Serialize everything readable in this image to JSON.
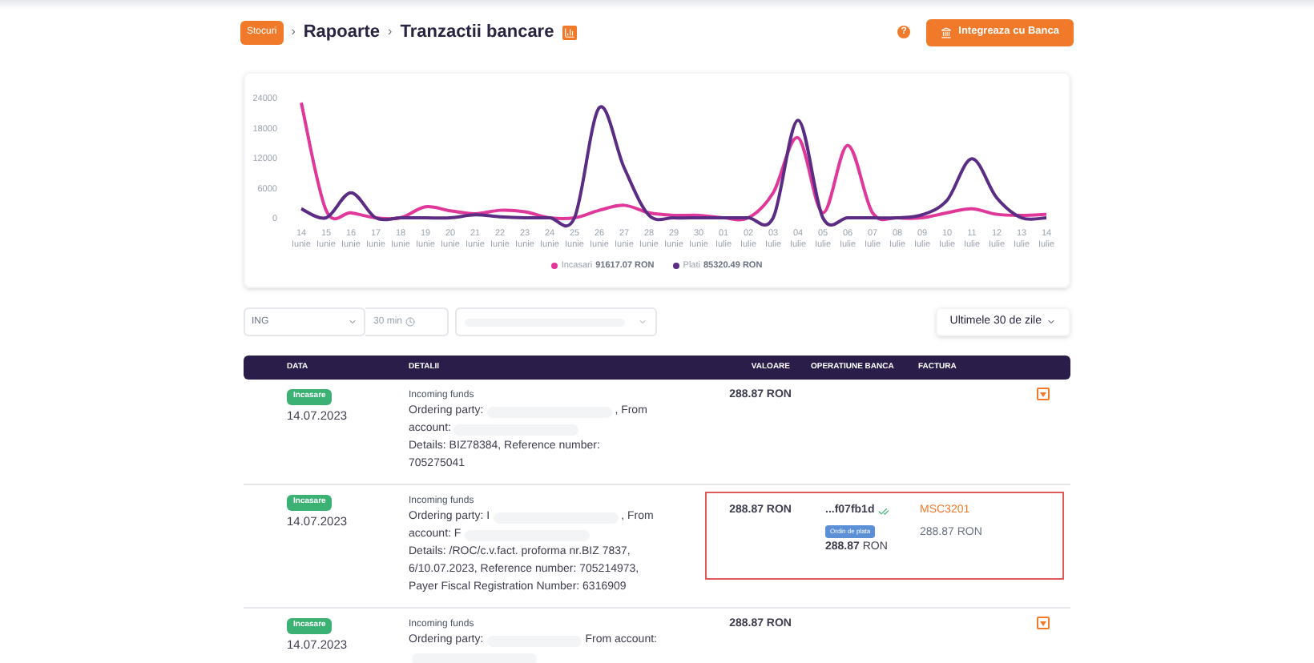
{
  "breadcrumb": [
    {
      "label": "Stocuri",
      "kind": "pill"
    },
    {
      "label": "Rapoarte",
      "kind": "link"
    },
    {
      "label": "Tranzactii bancare",
      "kind": "current"
    }
  ],
  "breadcrumb_separators": [
    "›",
    "›"
  ],
  "help": "?",
  "integrate_button": "Integreaza cu Banca",
  "chart": {
    "chart_data": {
      "type": "line",
      "categories": [
        "14 Iunie",
        "15 Iunie",
        "16 Iunie",
        "17 Iunie",
        "18 Iunie",
        "19 Iunie",
        "20 Iunie",
        "21 Iunie",
        "22 Iunie",
        "23 Iunie",
        "24 Iunie",
        "25 Iunie",
        "26 Iunie",
        "27 Iunie",
        "28 Iunie",
        "29 Iunie",
        "30 Iunie",
        "01 Iulie",
        "02 Iulie",
        "03 Iulie",
        "04 Iulie",
        "05 Iulie",
        "06 Iulie",
        "07 Iulie",
        "08 Iulie",
        "09 Iulie",
        "10 Iulie",
        "11 Iulie",
        "12 Iulie",
        "13 Iulie",
        "14 Iulie"
      ],
      "series": [
        {
          "name": "Incasari",
          "color": "#e0389a",
          "values": [
            23000,
            1500,
            1000,
            0,
            0,
            2200,
            1400,
            800,
            1500,
            1200,
            0,
            0,
            1500,
            2500,
            1000,
            500,
            500,
            0,
            0,
            5000,
            16000,
            1000,
            14500,
            1000,
            0,
            0,
            1000,
            1800,
            700,
            500,
            700
          ]
        },
        {
          "name": "Plati",
          "color": "#5b2c83",
          "values": [
            1800,
            0,
            5000,
            0,
            0,
            0,
            0,
            600,
            200,
            0,
            0,
            0,
            22000,
            10000,
            500,
            0,
            0,
            0,
            0,
            0,
            19500,
            0,
            0,
            0,
            0,
            600,
            3500,
            11800,
            4000,
            0,
            0
          ]
        }
      ],
      "ylim": [
        0,
        24000
      ],
      "yticks": [
        0,
        6000,
        12000,
        18000,
        24000
      ]
    },
    "legend_totals": [
      "91617.07 RON",
      "85320.49 RON"
    ]
  },
  "filters": {
    "bank": "ING",
    "time": "30 min",
    "period": "Ultimele 30 de zile"
  },
  "table": {
    "columns": [
      "DATA",
      "DETALII",
      "VALOARE",
      "OPERATIUNE BANCA",
      "FACTURA"
    ],
    "rows": [
      {
        "badge": "Incasare",
        "date": "14.07.2023",
        "title": "Incoming funds",
        "details": [
          [
            {
              "kind": "text",
              "text": "Ordering party:"
            },
            {
              "kind": "redacted"
            },
            {
              "kind": "text",
              "text": ", From"
            }
          ],
          [
            {
              "kind": "text",
              "text": "account:"
            },
            {
              "kind": "redacted"
            }
          ],
          [
            {
              "kind": "text",
              "text": "Details: BIZ78384, Reference number:"
            }
          ],
          [
            {
              "kind": "text",
              "text": "705275041"
            }
          ]
        ],
        "value": "288.87 RON",
        "highlighted": false,
        "action": true
      },
      {
        "badge": "Incasare",
        "date": "14.07.2023",
        "title": "Incoming funds",
        "details": [
          [
            {
              "kind": "text",
              "text": "Ordering party: I"
            },
            {
              "kind": "redacted"
            },
            {
              "kind": "text",
              "text": ", From"
            }
          ],
          [
            {
              "kind": "text",
              "text": "account: F"
            },
            {
              "kind": "redacted"
            }
          ],
          [
            {
              "kind": "text",
              "text": "Details: /ROC/c.v.fact. proforma nr.BIZ 7837,"
            }
          ],
          [
            {
              "kind": "text",
              "text": "6/10.07.2023, Reference number: 705214973,"
            }
          ],
          [
            {
              "kind": "text",
              "text": "Payer Fiscal Registration Number: 6316909"
            }
          ]
        ],
        "value": "288.87 RON",
        "highlighted": true,
        "action": false,
        "operation": {
          "ref": "...f07fb1d",
          "verified": true,
          "tag": "Ordin de plata",
          "amount": "**288.87** RON"
        },
        "invoice": {
          "number": "MSC3201",
          "amount": "288.87 RON"
        }
      },
      {
        "badge": "Incasare",
        "date": "14.07.2023",
        "title": "Incoming funds",
        "details": [
          [
            {
              "kind": "text",
              "text": "Ordering party:"
            },
            {
              "kind": "redacted"
            },
            {
              "kind": "text",
              "text": "From account:"
            }
          ],
          [
            {
              "kind": "redacted"
            }
          ]
        ],
        "value": "288.87 RON",
        "highlighted": false,
        "action": true
      }
    ]
  }
}
